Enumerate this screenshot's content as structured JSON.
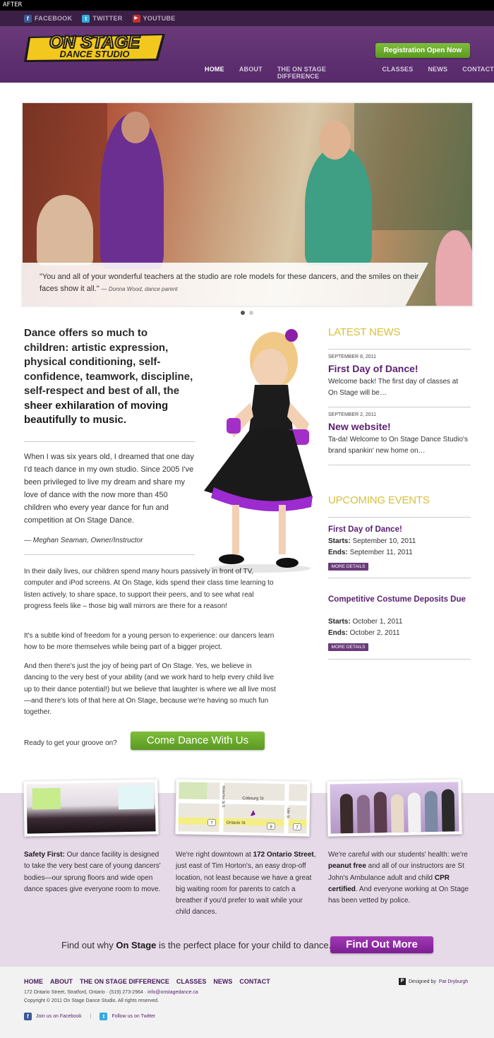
{
  "after_label": "AFTER",
  "social": {
    "facebook": "FACEBOOK",
    "twitter": "TWITTER",
    "youtube": "YOUTUBE"
  },
  "header": {
    "logo_line1": "ON STAGE",
    "logo_line2": "DANCE STUDIO",
    "registration_button": "Registration Open Now",
    "nav": [
      "HOME",
      "ABOUT",
      "THE ON STAGE DIFFERENCE",
      "CLASSES",
      "NEWS",
      "CONTACT"
    ]
  },
  "hero": {
    "quote": "\"You and all of your wonderful teachers at the studio are role models for these dancers, and the smiles on their faces show it all.\"",
    "cite": "— Donna Wood, dance parent"
  },
  "intro": {
    "lead": "Dance offers so much to children: artistic expression, physical conditioning, self-confidence, teamwork, discipline, self-respect and best of all, the ",
    "emph": "sheer exhilaration of moving beautifully to music."
  },
  "bio": {
    "text": "When I was six years old, I dreamed that one day I'd teach dance in my own studio. Since 2005 I've been privileged to live my dream and share my love of dance with the now more than 450 children who every year dance for fun and competition at On Stage Dance.",
    "signature": "— Meghan Seaman, Owner/Instructor"
  },
  "body": {
    "p1": "In their daily lives, our children spend many hours passively in front of TV, computer and iPod screens. At On Stage, kids spend their class time learning to listen actively, to share space, to support their peers, and to see what real progress feels like – those big wall mirrors are there for a reason!",
    "p2": "It's a subtle kind of freedom for a young person to experience: our dancers learn how to be more themselves while being part of a bigger project.",
    "p3": "And then there's just the joy of being part of On Stage. Yes, we believe in dancing to the very best of your ability (and we work hard to help every child live up to their dance potential!) but we believe that laughter is where we all live most—and there's lots of that here at On Stage, because we're having so much fun together."
  },
  "cta": {
    "question": "Ready to get your groove on?",
    "button": "Come Dance With Us"
  },
  "latest_news": {
    "heading": "LATEST NEWS",
    "items": [
      {
        "date": "SEPTEMBER 8, 2011",
        "title": "First Day of Dance!",
        "excerpt": "Welcome back! The first day of classes at On Stage will be…"
      },
      {
        "date": "SEPTEMBER 2, 2011",
        "title": "New website!",
        "excerpt": "Ta-da! Welcome to On Stage Dance Studio's brand spankin' new home on…"
      }
    ]
  },
  "events": {
    "heading": "UPCOMING EVENTS",
    "starts_label": "Starts:",
    "ends_label": "Ends:",
    "more_label": "MORE DETAILS",
    "items": [
      {
        "title": "First Day of Dance!",
        "starts": "September 10, 2011",
        "ends": "September 11, 2011"
      },
      {
        "title": "Competitive Costume Deposits Due",
        "starts": "October 1, 2011",
        "ends": "October 2, 2011"
      }
    ]
  },
  "map": {
    "cobourg": "Cobourg St",
    "ontario": "Ontario St",
    "waterloo": "Waterloo St S",
    "nile": "Nile St",
    "route1": "7",
    "route2": "8",
    "route3": "7"
  },
  "features": {
    "f1_bold": "Safety First:",
    "f1_text": " Our dance facility is designed to take the very best care of young dancers' bodies—our sprung floors and wide open dance spaces give everyone room to move.",
    "f2_a": "We're right downtown at ",
    "f2_bold": "172 Ontario Street",
    "f2_b": ", just east of Tim Horton's, an easy drop-off location, not least because we have a great big waiting room for parents to catch a breather if you'd prefer to wait while your child dances.",
    "f3_a": "We're careful with our students' health: we're ",
    "f3_bold1": "peanut free",
    "f3_b": " and all of our instructors are St John's Ambulance adult and child ",
    "f3_bold2": "CPR certified",
    "f3_c": ". And everyone working at On Stage has been vetted by police."
  },
  "band_cta": {
    "text_a": "Find out why ",
    "text_bold": "On Stage",
    "text_b": " is the perfect place for your child to dance.",
    "button": "Find Out More"
  },
  "footer": {
    "nav": [
      "HOME",
      "ABOUT",
      "THE ON STAGE DIFFERENCE",
      "CLASSES",
      "NEWS",
      "CONTACT"
    ],
    "address": "172 Ontario Street, Stratford, Ontario · (519) 273-2964 · ",
    "email": "info@onstagedance.ca",
    "copyright": "Copyright © 2011 On Stage Dance Studio. All rights reserved.",
    "facebook": "Join us on Facebook",
    "sep": "|",
    "twitter": "Follow us on Twitter",
    "designed_by": "Designed by ",
    "designer": "Pat Dryburgh"
  },
  "colors": {
    "purple": "#57296a",
    "green": "#6aa82c",
    "gold": "#d8c13a",
    "lavender": "#e6d9e8"
  }
}
